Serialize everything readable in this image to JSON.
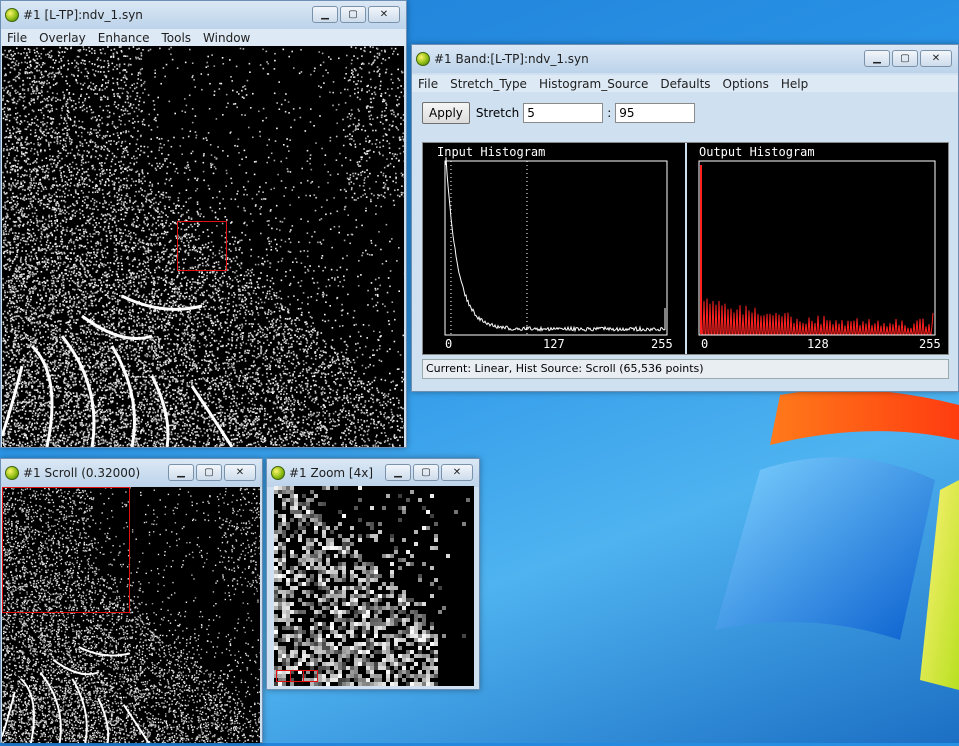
{
  "image_window": {
    "title": "#1 [L-TP]:ndv_1.syn",
    "menu": [
      "File",
      "Overlay",
      "Enhance",
      "Tools",
      "Window"
    ]
  },
  "band_window": {
    "title": "#1 Band:[L-TP]:ndv_1.syn",
    "menu": [
      "File",
      "Stretch_Type",
      "Histogram_Source",
      "Defaults",
      "Options",
      "Help"
    ],
    "apply_label": "Apply",
    "stretch_label": "Stretch",
    "stretch_min": "5",
    "separator": ":",
    "stretch_max": "95",
    "input_histogram": {
      "title": "Input Histogram",
      "ticks": [
        "0",
        "127",
        "255"
      ]
    },
    "output_histogram": {
      "title": "Output Histogram",
      "ticks": [
        "0",
        "128",
        "255"
      ]
    },
    "status": "Current: Linear, Hist Source: Scroll (65,536 points)"
  },
  "scroll_window": {
    "title": "#1 Scroll (0.32000)"
  },
  "zoom_window": {
    "title": "#1 Zoom [4x]"
  },
  "controls": {
    "minimize": "▁",
    "maximize": "▢",
    "close": "✕"
  },
  "colors": {
    "selection_box": "#e01010",
    "output_histogram": "#ff2020",
    "input_histogram": "#ffffff"
  },
  "icons": {
    "app": "envi-globe-icon"
  }
}
